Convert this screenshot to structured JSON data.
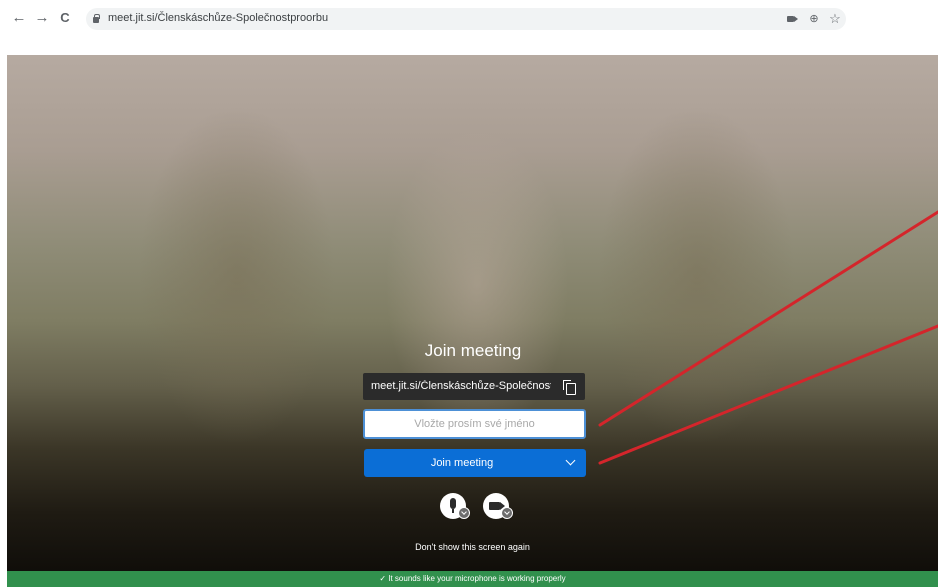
{
  "browser": {
    "back_glyph": "←",
    "forward_glyph": "→",
    "reload_glyph": "C",
    "url": "meet.jit.si/Členskáschůze-Společnostproorbu",
    "zoom_glyph": "⊕",
    "star_glyph": "☆"
  },
  "prejoin": {
    "title": "Join meeting",
    "meeting_url": "meet.jit.si/Členskáschůze-Společnost...",
    "name_placeholder": "Vložte prosím své jméno",
    "name_value": "",
    "join_label": "Join meeting",
    "dont_show_label": "Don't show this screen again"
  },
  "status": {
    "message": "✓  It sounds like your microphone is working properly"
  },
  "colors": {
    "join_button": "#0b6ed6",
    "status_bar": "#31904d",
    "input_border": "#4d90d6",
    "annotation": "#d4252b"
  }
}
